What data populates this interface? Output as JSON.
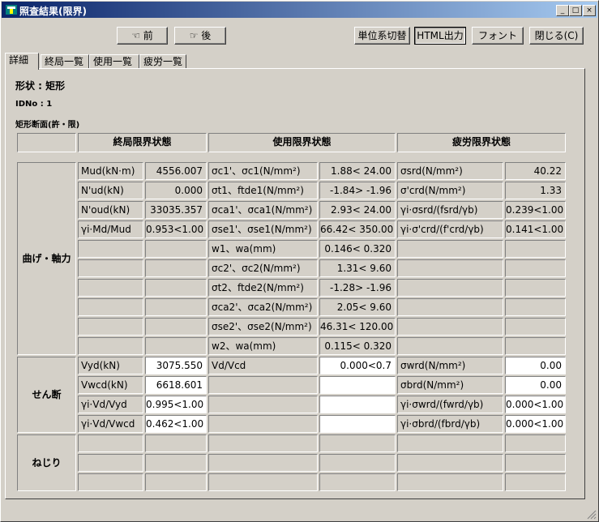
{
  "window": {
    "title": "照査結果(限界)",
    "controls": [
      "_",
      "□",
      "×"
    ]
  },
  "toolbar": {
    "prev_label": "前",
    "next_label": "後",
    "unit_label": "単位系切替",
    "html_label": "HTML出力",
    "font_label": "フォント",
    "close_label": "閉じる(C)"
  },
  "tabs": [
    "詳細",
    "終局一覧",
    "使用一覧",
    "疲労一覧"
  ],
  "header": {
    "shape": "形状 : 矩形",
    "idno": "IDNo : 1",
    "section": "矩形断面(許・限)"
  },
  "columns": {
    "ultimate": "終局限界状態",
    "service": "使用限界状態",
    "fatigue": "疲労限界状態"
  },
  "groups": {
    "bending": "曲げ・軸力",
    "shear": "せん断",
    "torsion": "ねじり"
  },
  "rows": [
    {
      "ul": "Mud(kN·m)",
      "uv": "4556.007",
      "sl": "σc1'、σc1(N/mm²)",
      "sv": "1.88< 24.00",
      "fl": "σsrd(N/mm²)",
      "fv": "40.22"
    },
    {
      "ul": "N'ud(kN)",
      "uv": "0.000",
      "sl": "σt1、ftde1(N/mm²)",
      "sv": "-1.84> -1.96",
      "fl": "σ'crd(N/mm²)",
      "fv": "1.33"
    },
    {
      "ul": "N'oud(kN)",
      "uv": "33035.357",
      "sl": "σca1'、σca1(N/mm²)",
      "sv": "2.93< 24.00",
      "fl": "γi·σsrd/(fsrd/γb)",
      "fv": "0.239<1.00"
    },
    {
      "ul": "γi·Md/Mud",
      "uv": "0.953<1.00",
      "sl": "σse1'、σse1(N/mm²)",
      "sv": "66.42< 350.00",
      "fl": "γi·σ'crd/(f'crd/γb)",
      "fv": "0.141<1.00"
    },
    {
      "ul": "",
      "uv": "",
      "sl": "w1、wa(mm)",
      "sv": "0.146< 0.320",
      "fl": "",
      "fv": ""
    },
    {
      "ul": "",
      "uv": "",
      "sl": "σc2'、σc2(N/mm²)",
      "sv": "1.31< 9.60",
      "fl": "",
      "fv": ""
    },
    {
      "ul": "",
      "uv": "",
      "sl": "σt2、ftde2(N/mm²)",
      "sv": "-1.28> -1.96",
      "fl": "",
      "fv": ""
    },
    {
      "ul": "",
      "uv": "",
      "sl": "σca2'、σca2(N/mm²)",
      "sv": "2.05< 9.60",
      "fl": "",
      "fv": ""
    },
    {
      "ul": "",
      "uv": "",
      "sl": "σse2'、σse2(N/mm²)",
      "sv": "46.31< 120.00",
      "fl": "",
      "fv": ""
    },
    {
      "ul": "",
      "uv": "",
      "sl": "w2、wa(mm)",
      "sv": "0.115< 0.320",
      "fl": "",
      "fv": ""
    },
    {
      "ul": "Vyd(kN)",
      "uv": "3075.550",
      "sl": "Vd/Vcd",
      "sv": "0.000<0.7",
      "fl": "σwrd(N/mm²)",
      "fv": "0.00"
    },
    {
      "ul": "Vwcd(kN)",
      "uv": "6618.601",
      "sl": "",
      "sv": "",
      "fl": "σbrd(N/mm²)",
      "fv": "0.00"
    },
    {
      "ul": "γi·Vd/Vyd",
      "uv": "0.995<1.00",
      "sl": "",
      "sv": "",
      "fl": "γi·σwrd/(fwrd/γb)",
      "fv": "0.000<1.00"
    },
    {
      "ul": "γi·Vd/Vwcd",
      "uv": "0.462<1.00",
      "sl": "",
      "sv": "",
      "fl": "γi·σbrd/(fbrd/γb)",
      "fv": "0.000<1.00"
    },
    {
      "ul": "",
      "uv": "",
      "sl": "",
      "sv": "",
      "fl": "",
      "fv": ""
    },
    {
      "ul": "",
      "uv": "",
      "sl": "",
      "sv": "",
      "fl": "",
      "fv": ""
    },
    {
      "ul": "",
      "uv": "",
      "sl": "",
      "sv": "",
      "fl": "",
      "fv": ""
    }
  ]
}
